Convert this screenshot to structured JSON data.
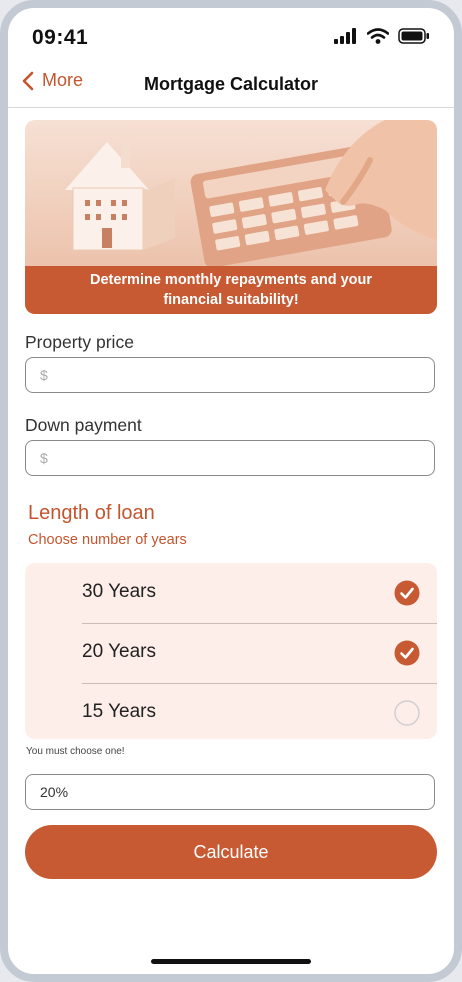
{
  "status": {
    "time": "09:41"
  },
  "nav": {
    "back_label": "More",
    "title": "Mortgage Calculator"
  },
  "hero": {
    "caption_line1": "Determine monthly repayments and your",
    "caption_line2": "financial suitability!"
  },
  "form": {
    "property_price": {
      "label": "Property price",
      "placeholder": "$",
      "value": ""
    },
    "down_payment": {
      "label": "Down payment",
      "placeholder": "$",
      "value": ""
    },
    "loan": {
      "title": "Length of loan",
      "subtitle": "Choose number of years",
      "options": [
        {
          "label": "30 Years",
          "checked": true
        },
        {
          "label": "20 Years",
          "checked": true
        },
        {
          "label": "15 Years",
          "checked": false
        }
      ],
      "warning": "You must choose one!"
    },
    "percent": {
      "value": "20%"
    },
    "calculate_label": "Calculate"
  },
  "colors": {
    "accent": "#c85a33",
    "options_bg": "#fdeeea"
  },
  "icons": [
    "chevron-left-icon",
    "cellular-signal-icon",
    "wifi-icon",
    "battery-icon",
    "checkmark-icon"
  ]
}
